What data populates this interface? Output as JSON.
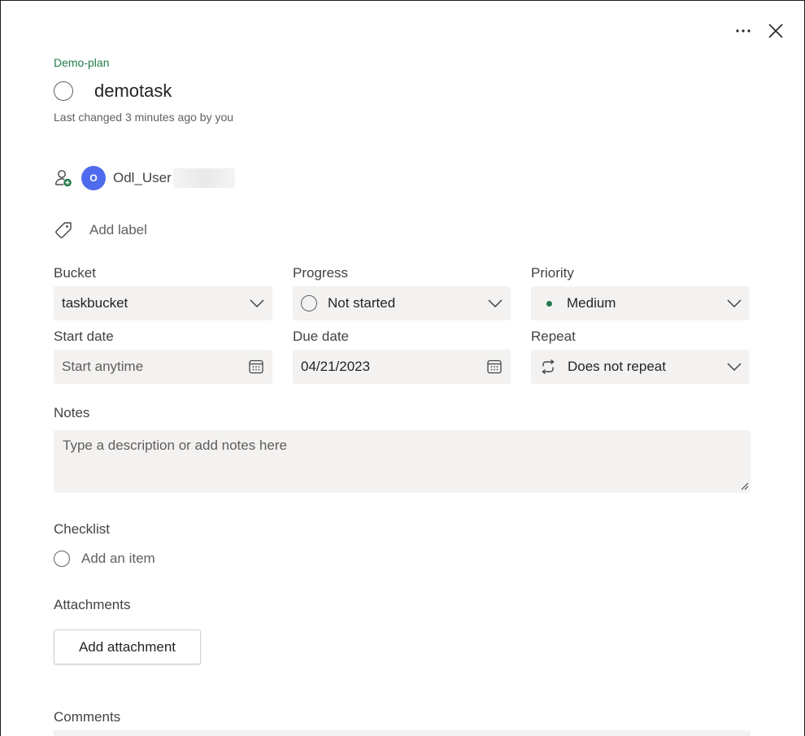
{
  "plan_name": "Demo-plan",
  "task": {
    "title": "demotask",
    "last_changed": "Last changed 3 minutes ago by you"
  },
  "assignee": {
    "initial": "O",
    "name": "Odl_User",
    "avatar_color": "#4f6bed"
  },
  "label": {
    "add_label": "Add label"
  },
  "fields": {
    "bucket": {
      "label": "Bucket",
      "value": "taskbucket"
    },
    "progress": {
      "label": "Progress",
      "value": "Not started"
    },
    "priority": {
      "label": "Priority",
      "value": "Medium",
      "dot_color": "#237b4b"
    },
    "start_date": {
      "label": "Start date",
      "placeholder": "Start anytime"
    },
    "due_date": {
      "label": "Due date",
      "value": "04/21/2023"
    },
    "repeat": {
      "label": "Repeat",
      "value": "Does not repeat"
    }
  },
  "notes": {
    "label": "Notes",
    "placeholder": "Type a description or add notes here"
  },
  "checklist": {
    "label": "Checklist",
    "add_item": "Add an item"
  },
  "attachments": {
    "label": "Attachments",
    "add_button": "Add attachment"
  },
  "comments": {
    "label": "Comments"
  },
  "colors": {
    "accent_green": "#237b4b",
    "field_bg": "#f3f2f1"
  }
}
